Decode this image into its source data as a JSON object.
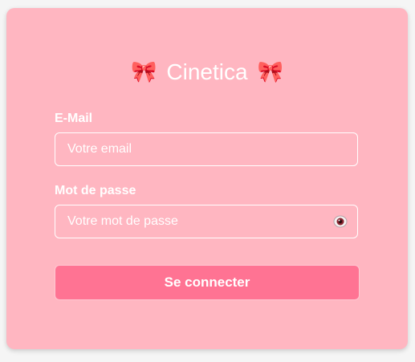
{
  "login": {
    "title": "Cinetica",
    "title_icon": "ribbon-bow-icon",
    "email": {
      "label": "E-Mail",
      "placeholder": "Votre email",
      "value": ""
    },
    "password": {
      "label": "Mot de passe",
      "placeholder": "Votre mot de passe",
      "value": "",
      "toggle_icon": "eye-icon"
    },
    "submit_label": "Se connecter"
  },
  "colors": {
    "card_background": "#ffb6c1",
    "button_background": "#ff7393",
    "text": "#ffffff"
  }
}
